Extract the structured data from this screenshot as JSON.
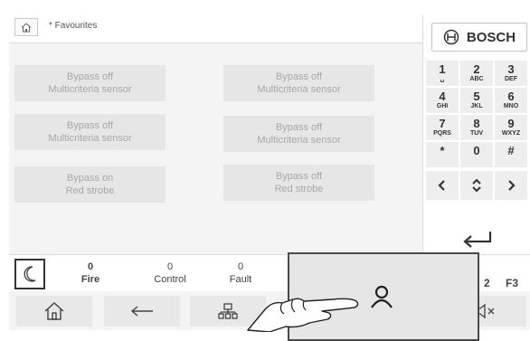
{
  "header": {
    "favourites_label": "* Favourites"
  },
  "functions": [
    {
      "line1": "Bypass off",
      "line2": "Multicriteria sensor"
    },
    {
      "line1": "Bypass off",
      "line2": "Multicriteria sensor"
    },
    {
      "line1": "Bypass off",
      "line2": "Multicriteria sensor"
    },
    {
      "line1": "Bypass off",
      "line2": "Multicriteria sensor"
    },
    {
      "line1": "Bypass on",
      "line2": "Red strobe"
    },
    {
      "line1": "Bypass off",
      "line2": "Red strobe"
    }
  ],
  "brand": {
    "name": "BOSCH"
  },
  "keypad": [
    {
      "num": "1",
      "letters": "␣"
    },
    {
      "num": "2",
      "letters": "ABC"
    },
    {
      "num": "3",
      "letters": "DEF"
    },
    {
      "num": "4",
      "letters": "GHI"
    },
    {
      "num": "5",
      "letters": "JKL"
    },
    {
      "num": "6",
      "letters": "MNO"
    },
    {
      "num": "7",
      "letters": "PQRS"
    },
    {
      "num": "8",
      "letters": "TUV"
    },
    {
      "num": "9",
      "letters": "WXYZ"
    },
    {
      "num": "*",
      "letters": ""
    },
    {
      "num": "0",
      "letters": ""
    },
    {
      "num": "#",
      "letters": ""
    }
  ],
  "counters": {
    "fire": {
      "count": "0",
      "label": "Fire"
    },
    "control": {
      "count": "0",
      "label": "Control"
    },
    "fault": {
      "count": "0",
      "label": "Fault"
    }
  },
  "fkeys": {
    "f2": "2",
    "f3": "F3"
  },
  "colors": {
    "accent": "#333333",
    "button_bg": "#e6e6e6",
    "disabled_text": "#a8a8a8"
  }
}
